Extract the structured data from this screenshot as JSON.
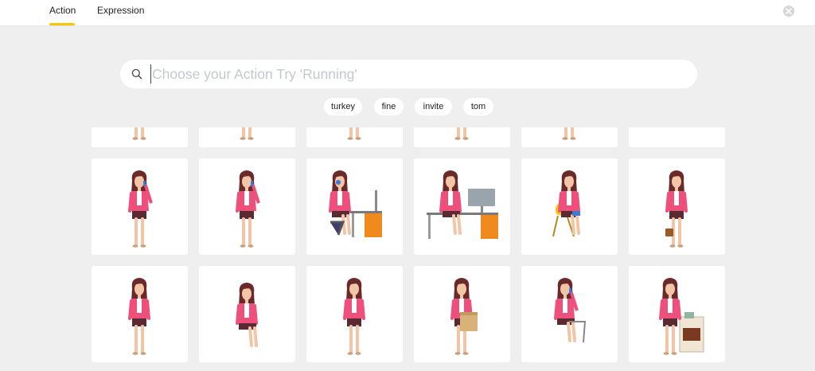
{
  "tabs": [
    {
      "label": "Action",
      "active": true
    },
    {
      "label": "Expression",
      "active": false
    }
  ],
  "search": {
    "placeholder": "Choose your Action Try 'Running'",
    "value": ""
  },
  "suggestions": [
    "turkey",
    "fine",
    "invite",
    "tom"
  ],
  "colors": {
    "accent": "#f7c600",
    "page_bg": "#efefef",
    "card_bg": "#ffffff",
    "character_top": "#ee4f7b",
    "character_hair": "#6b2a2a",
    "character_skin": "#f2c5a6",
    "desk_orange": "#f08a1e"
  },
  "characters": [
    [
      "standing",
      "standing",
      "standing",
      "standing",
      "standing",
      "desk-chair"
    ],
    [
      "phone-standing",
      "phone-standing",
      "desk-headset",
      "desk-computer",
      "sitting-chair",
      "standing-bag"
    ],
    [
      "standing-arms-crossed",
      "sitting-thinking",
      "standing-gesturing",
      "carrying-box",
      "sitting-phone",
      "cooking-stove"
    ]
  ]
}
